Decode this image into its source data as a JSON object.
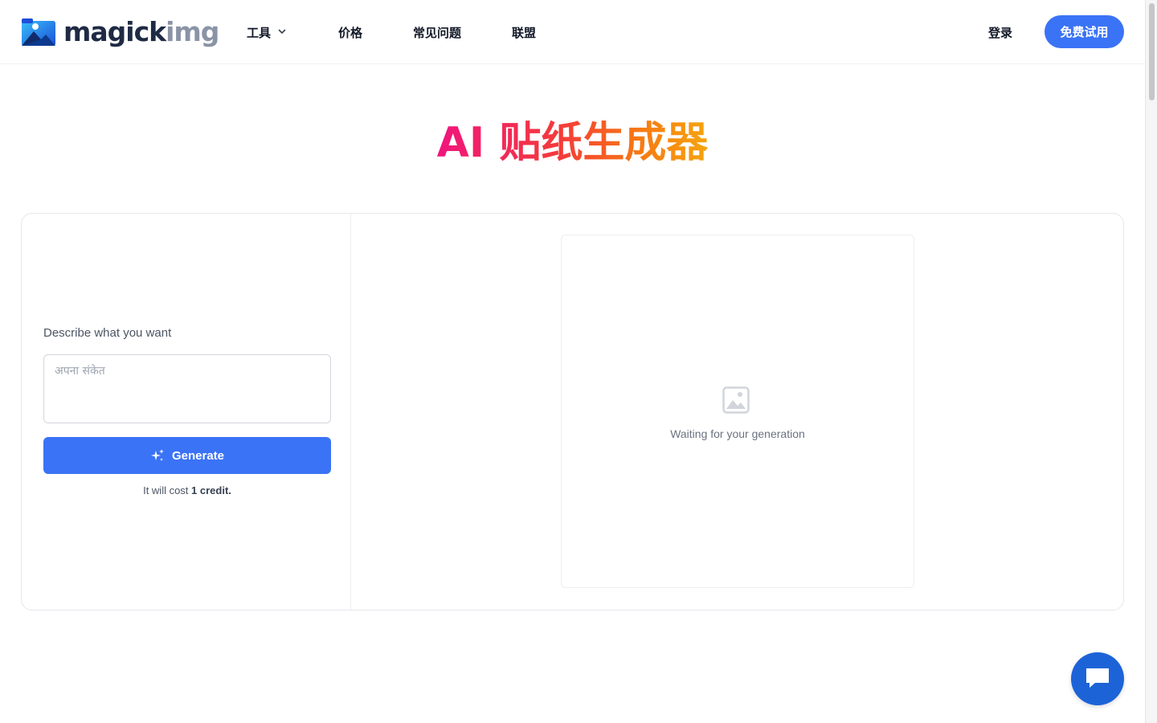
{
  "header": {
    "logo": {
      "part1": "magick",
      "part2": "img"
    },
    "nav": {
      "tools": "工具",
      "pricing": "价格",
      "faq": "常见问题",
      "alliance": "联盟"
    },
    "login": "登录",
    "trial_button": "免费试用"
  },
  "main": {
    "title": "AI 贴纸生成器",
    "form": {
      "label": "Describe what you want",
      "prompt_placeholder": "अपना संकेत",
      "prompt_value": "",
      "generate_label": "Generate",
      "cost_prefix": "It will cost ",
      "cost_value": "1 credit."
    },
    "preview": {
      "waiting_text": "Waiting for your generation"
    }
  },
  "colors": {
    "primary": "#3b73f6",
    "title_gradient": [
      "#f0157e",
      "#f43a3a",
      "#f77a12",
      "#f5a40f"
    ],
    "chat": "#1d63d8"
  },
  "icons": {
    "logo": "mountain-image-icon",
    "tools_dropdown": "chevron-down-icon",
    "generate": "sparkle-icon",
    "preview": "image-placeholder-icon",
    "chat": "chat-bubble-icon"
  }
}
